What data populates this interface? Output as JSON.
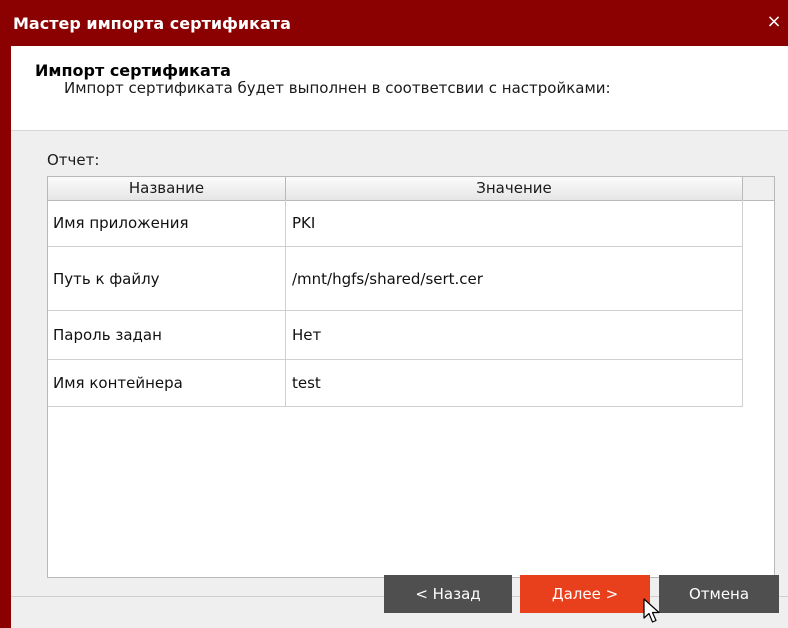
{
  "window": {
    "title": "Мастер импорта сертификата",
    "close_symbol": "×"
  },
  "header": {
    "title": "Импорт сертификата",
    "description": "Импорт сертификата будет выполнен в соответсвии с настройками:"
  },
  "report": {
    "label": "Отчет:",
    "columns": [
      "Название",
      "Значение"
    ],
    "rows": [
      {
        "name": "Имя приложения",
        "value": "PKI"
      },
      {
        "name": "Путь к файлу",
        "value": "/mnt/hgfs/shared/sert.cer"
      },
      {
        "name": "Пароль задан",
        "value": "Нет"
      },
      {
        "name": "Имя контейнера",
        "value": "test"
      }
    ]
  },
  "buttons": {
    "back": "< Назад",
    "next": "Далее >",
    "cancel": "Отмена"
  },
  "colors": {
    "titlebar": "#8b0000",
    "primary_button": "#e8401c",
    "secondary_button": "#4f4f4f"
  },
  "icons": {
    "close": "close-icon",
    "cursor": "mouse-pointer-icon"
  }
}
